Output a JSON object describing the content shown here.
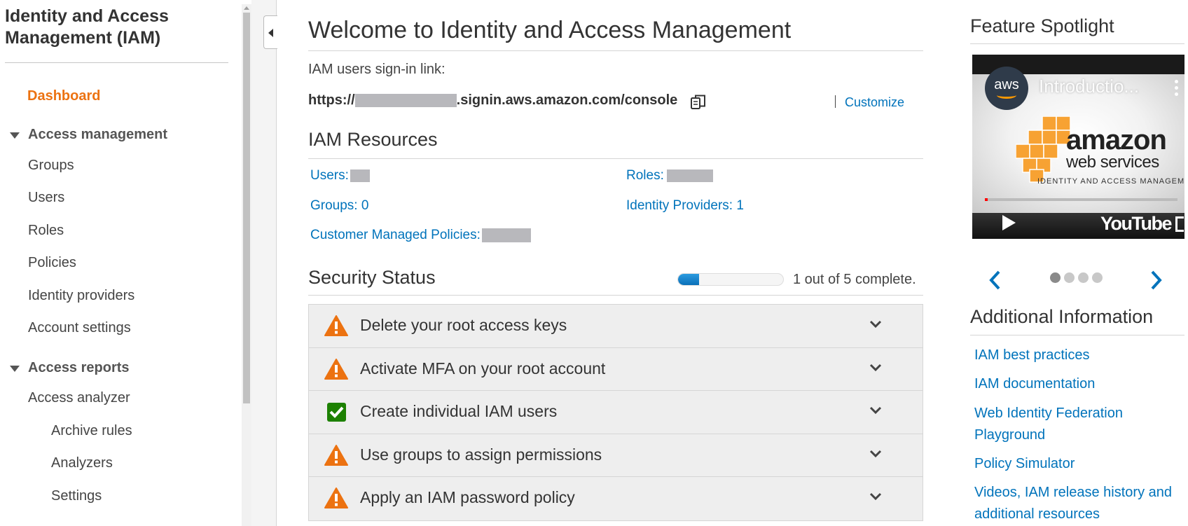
{
  "sidebar": {
    "title": "Identity and Access Management (IAM)",
    "dashboard": "Dashboard",
    "access_management": {
      "label": "Access management",
      "items": [
        "Groups",
        "Users",
        "Roles",
        "Policies",
        "Identity providers",
        "Account settings"
      ]
    },
    "access_reports": {
      "label": "Access reports",
      "analyzer": "Access analyzer",
      "analyzer_items": [
        "Archive rules",
        "Analyzers",
        "Settings"
      ]
    }
  },
  "main": {
    "title": "Welcome to Identity and Access Management",
    "signin_label": "IAM users sign-in link:",
    "signin_url_prefix": "https://",
    "signin_url_suffix": ".signin.aws.amazon.com/console",
    "customize": "Customize",
    "resources": {
      "heading": "IAM Resources",
      "users": "Users:",
      "roles": "Roles:",
      "groups": "Groups: 0",
      "identity_providers": "Identity Providers: 1",
      "customer_policies": "Customer Managed Policies:"
    },
    "security": {
      "heading": "Security Status",
      "progress_text": "1 out of 5 complete.",
      "progress_fraction": 0.2,
      "items": [
        {
          "label": "Delete your root access keys",
          "status": "warning"
        },
        {
          "label": "Activate MFA on your root account",
          "status": "warning"
        },
        {
          "label": "Create individual IAM users",
          "status": "complete"
        },
        {
          "label": "Use groups to assign permissions",
          "status": "warning"
        },
        {
          "label": "Apply an IAM password policy",
          "status": "warning"
        }
      ]
    }
  },
  "right": {
    "spotlight_heading": "Feature Spotlight",
    "video": {
      "logo_text": "aws",
      "title": "Introductio...",
      "brand_line1": "amazon",
      "brand_line2": "web services",
      "subtitle": "IDENTITY AND ACCESS MANAGEMENT",
      "player": "YouTube"
    },
    "carousel": {
      "count": 4,
      "active": 0
    },
    "additional_heading": "Additional Information",
    "links": [
      "IAM best practices",
      "IAM documentation",
      "Web Identity Federation Playground",
      "Policy Simulator",
      "Videos, IAM release history and additional resources"
    ]
  },
  "colors": {
    "link": "#0073bb",
    "accent_orange": "#ec7211",
    "warning": "#ec7211",
    "success": "#1d8102"
  }
}
